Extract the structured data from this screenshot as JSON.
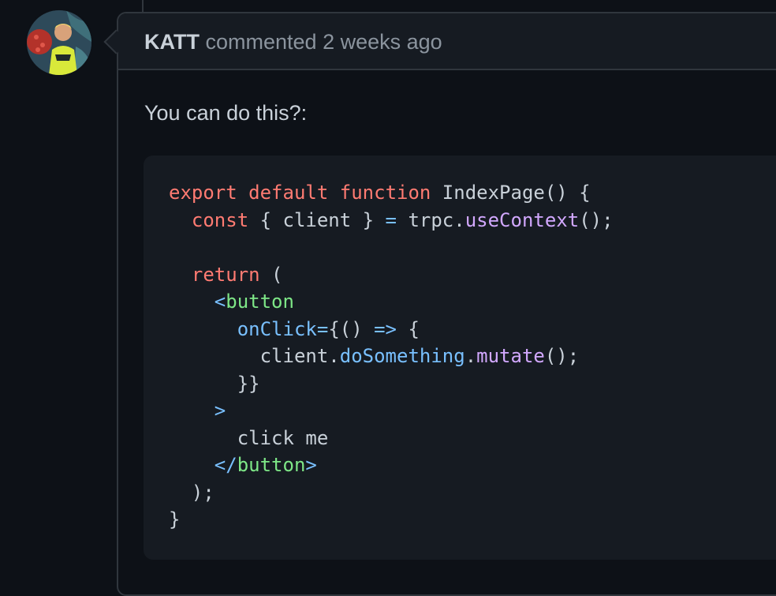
{
  "comment": {
    "author": "KATT",
    "action": "commented",
    "timestamp": "2 weeks ago",
    "body": "You can do this?:"
  },
  "code": {
    "language": "tsx",
    "lines": [
      "export default function IndexPage() {",
      "  const { client } = trpc.useContext();",
      "",
      "  return (",
      "    <button",
      "      onClick={() => {",
      "        client.doSomething.mutate();",
      "      }}",
      "    >",
      "      click me",
      "    </button>",
      "  );",
      "}"
    ],
    "tokens": {
      "l1_export": "export",
      "l1_default": "default",
      "l1_function": "function",
      "l1_name": " IndexPage() {",
      "l2_indent": "  ",
      "l2_const": "const",
      "l2_rest1": " { client } ",
      "l2_eq": "=",
      "l2_rest2": " trpc.",
      "l2_fn": "useContext",
      "l2_rest3": "();",
      "l4_indent": "  ",
      "l4_return": "return",
      "l4_rest": " (",
      "l5_indent": "    ",
      "l5_lt": "<",
      "l5_tag": "button",
      "l6_indent": "      ",
      "l6_attr": "onClick",
      "l6_eq": "=",
      "l6_rest1": "{() ",
      "l6_arrow": "=>",
      "l6_rest2": " {",
      "l7_indent": "        ",
      "l7_client": "client.",
      "l7_do": "doSomething",
      "l7_dot": ".",
      "l7_mutate": "mutate",
      "l7_rest": "();",
      "l8": "      }}",
      "l9_indent": "    ",
      "l9_gt": ">",
      "l10": "      click me",
      "l11_indent": "    ",
      "l11_open": "</",
      "l11_tag": "button",
      "l11_close": ">",
      "l12": "  );",
      "l13": "}"
    }
  },
  "colors": {
    "background": "#0d1117",
    "header_bg": "#161b22",
    "border": "#30363d",
    "keyword": "#ff7b72",
    "function": "#d2a8ff",
    "tag": "#7ee787",
    "attribute": "#79c0ff"
  }
}
